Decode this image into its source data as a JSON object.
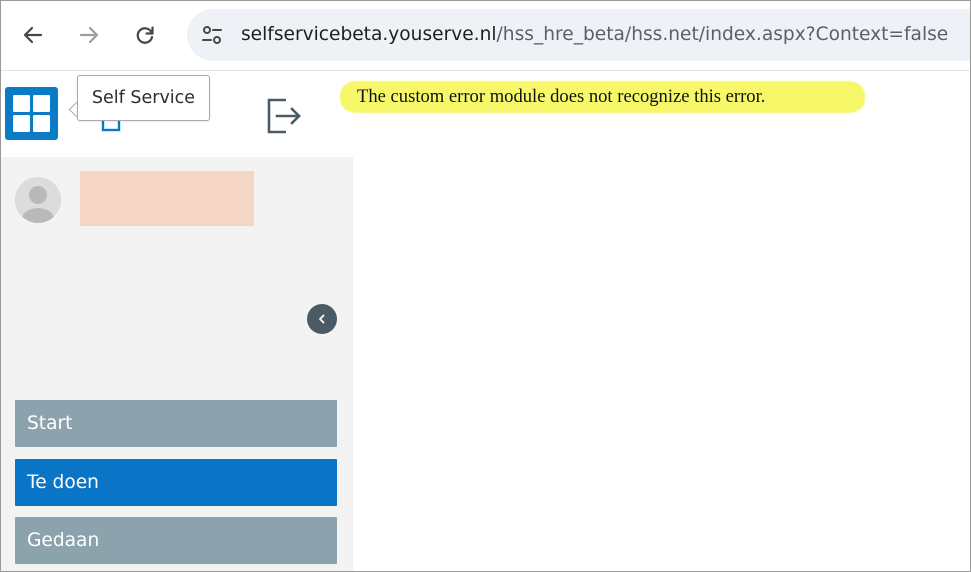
{
  "browser": {
    "url_host": "selfservicebeta.youserve.nl",
    "url_path": "/hss_hre_beta/hss.net/index.aspx?Context=false",
    "icons": {
      "back": "arrow-left-icon",
      "forward": "arrow-right-icon",
      "reload": "reload-icon",
      "site_info": "tune-icon"
    }
  },
  "header": {
    "tooltip": "Self Service",
    "icons": {
      "logo": "grid-icon",
      "document": "document-icon",
      "logout": "logout-icon"
    }
  },
  "sidebar": {
    "items": [
      {
        "label": "Start",
        "color": "#8ca2ad"
      },
      {
        "label": "Te doen",
        "color": "#0a74c6"
      },
      {
        "label": "Gedaan",
        "color": "#8ca2ad"
      }
    ],
    "collapse_icon": "chevron-left-icon"
  },
  "main": {
    "error_message": "The custom error module does not recognize this error."
  },
  "colors": {
    "accent": "#0a7bc4",
    "highlight": "#f6f86a",
    "redaction": "#f5d5c3"
  }
}
